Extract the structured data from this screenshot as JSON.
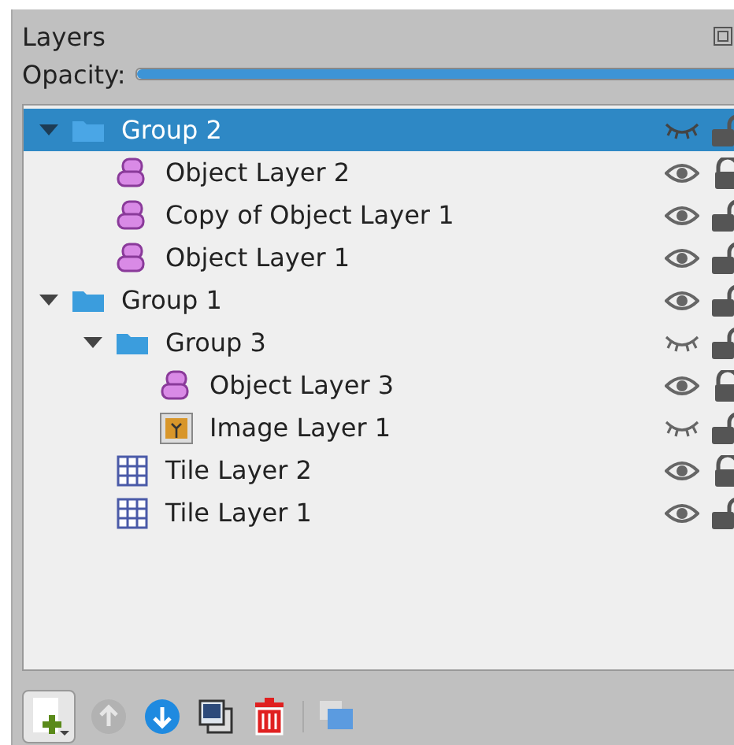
{
  "panel": {
    "title": "Layers"
  },
  "opacity": {
    "label": "Opacity:",
    "level": 1.0
  },
  "layers": [
    {
      "name": "Group 2",
      "kind": "group",
      "selected": true,
      "expanded": true,
      "visible": false,
      "locked": false,
      "children": [
        {
          "name": "Object Layer 2",
          "kind": "object",
          "selected": false,
          "visible": true,
          "locked": true
        },
        {
          "name": "Copy of Object Layer 1",
          "kind": "object",
          "selected": false,
          "visible": true,
          "locked": false
        },
        {
          "name": "Object Layer 1",
          "kind": "object",
          "selected": false,
          "visible": true,
          "locked": false
        }
      ]
    },
    {
      "name": "Group 1",
      "kind": "group",
      "selected": false,
      "expanded": true,
      "visible": true,
      "locked": false,
      "children": [
        {
          "name": "Group 3",
          "kind": "group",
          "selected": false,
          "expanded": true,
          "visible": false,
          "locked": false,
          "children": [
            {
              "name": "Object Layer 3",
              "kind": "object",
              "selected": false,
              "visible": true,
              "locked": true
            },
            {
              "name": "Image Layer 1",
              "kind": "image",
              "selected": false,
              "visible": false,
              "locked": false
            }
          ]
        },
        {
          "name": "Tile Layer 2",
          "kind": "tile",
          "selected": false,
          "visible": true,
          "locked": true
        },
        {
          "name": "Tile Layer 1",
          "kind": "tile",
          "selected": false,
          "visible": true,
          "locked": false
        }
      ]
    }
  ],
  "toolbar": [
    {
      "kind": "new",
      "disabled": false
    },
    {
      "kind": "raise",
      "disabled": true
    },
    {
      "kind": "lower",
      "disabled": false
    },
    {
      "kind": "duplicate",
      "disabled": false
    },
    {
      "kind": "delete",
      "disabled": false
    },
    {
      "kind": "separator"
    },
    {
      "kind": "properties",
      "disabled": false
    }
  ]
}
